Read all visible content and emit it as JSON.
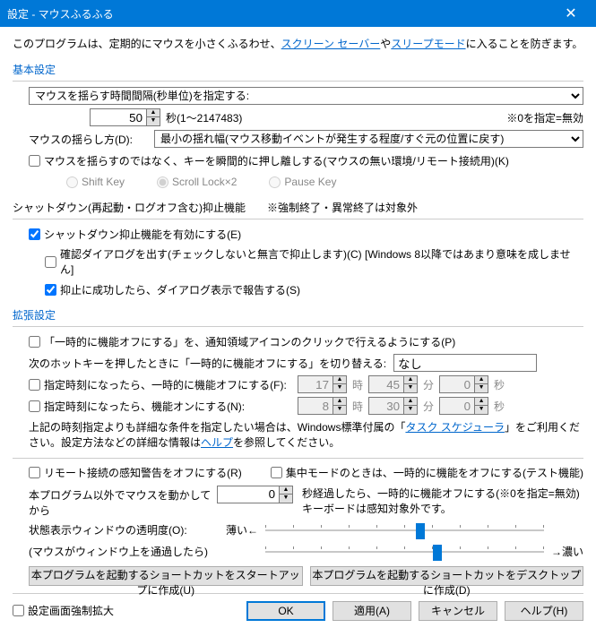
{
  "titlebar": {
    "title": "設定 - マウスふるふる"
  },
  "intro": {
    "prefix": "このプログラムは、定期的にマウスを小さくふるわせ、",
    "link1": "スクリーン セーバー",
    "mid": "や",
    "link2": "スリープモード",
    "suffix": "に入ることを防ぎます。"
  },
  "basic": {
    "heading": "基本設定",
    "interval_label": "マウスを揺らす時間間隔(秒単位)を指定する:",
    "interval_value": "50",
    "interval_unit": "秒(1～2147483)",
    "interval_note": "※0を指定=無効",
    "shake_method_label": "マウスの揺らし方(D):",
    "shake_method_value": "最小の揺れ幅(マウス移動イベントが発生する程度/すぐ元の位置に戻す)",
    "key_checkbox": "マウスを揺らすのではなく、キーを瞬間的に押し離しする(マウスの無い環境/リモート接続用)(K)",
    "radio_shift": "Shift Key",
    "radio_scroll": "Scroll Lock×2",
    "radio_pause": "Pause Key"
  },
  "shutdown": {
    "heading": "シャットダウン(再起動・ログオフ含む)抑止機能　　※強制終了・異常終了は対象外",
    "enable": "シャットダウン抑止機能を有効にする(E)",
    "confirm": "確認ダイアログを出す(チェックしないと無言で抑止します)(C) [Windows 8以降ではあまり意味を成しません]",
    "report": "抑止に成功したら、ダイアログ表示で報告する(S)"
  },
  "ext": {
    "heading": "拡張設定",
    "tray_off": "「一時的に機能オフにする」を、通知領域アイコンのクリックで行えるようにする(P)",
    "hotkey_label": "次のホットキーを押したときに「一時的に機能オフにする」を切り替える:",
    "hotkey_value": "なし",
    "time_off": "指定時刻になったら、一時的に機能オフにする(F):",
    "time_off_h": "17",
    "time_off_m": "45",
    "time_off_s": "0",
    "time_on": "指定時刻になったら、機能オンにする(N):",
    "time_on_h": "8",
    "time_on_m": "30",
    "time_on_s": "0",
    "unit_h": "時",
    "unit_m": "分",
    "unit_s": "秒",
    "note_prefix": "上記の時刻指定よりも詳細な条件を指定したい場合は、Windows標準付属の「",
    "note_link1": "タスク スケジューラ",
    "note_mid": "」をご利用ください。設定方法などの詳細な情報は",
    "note_link2": "ヘルプ",
    "note_suffix": "を参照してください。",
    "remote_off": "リモート接続の感知警告をオフにする(R)",
    "focus_off": "集中モードのときは、一時的に機能をオフにする(テスト機能)",
    "external_label": "本プログラム以外でマウスを動かしてから",
    "external_value": "0",
    "external_note1": "秒経過したら、一時的に機能オフにする(※0を指定=無効)",
    "external_note2": "キーボードは感知対象外です。",
    "opacity_label": "状態表示ウィンドウの透明度(O):",
    "opacity_sub": "(マウスがウィンドウ上を通過したら)",
    "opacity_left": "薄い←",
    "opacity_right": "→濃い",
    "shortcut_startup": "本プログラムを起動するショートカットをスタートアップに作成(U)",
    "shortcut_desktop": "本プログラムを起動するショートカットをデスクトップに作成(D)"
  },
  "bottom": {
    "force_expand": "設定画面強制拡大",
    "ok": "OK",
    "apply": "適用(A)",
    "cancel": "キャンセル",
    "help": "ヘルプ(H)"
  }
}
